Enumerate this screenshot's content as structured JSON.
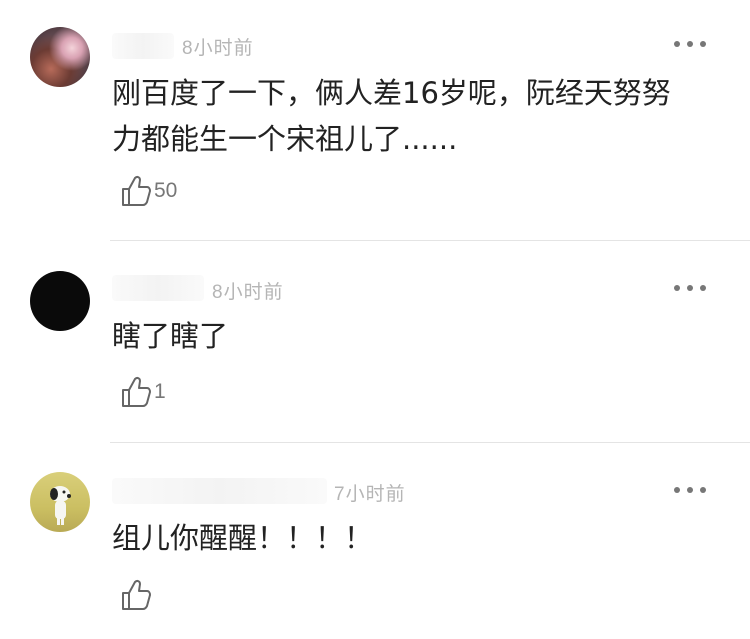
{
  "comments": [
    {
      "time": "8小时前",
      "text_line1": "刚百度了一下，俩人差16岁呢，阮经天努努",
      "text_line2": "力都能生一个宋祖儿了......",
      "likes": "50"
    },
    {
      "time": "8小时前",
      "text_line1": "瞎了瞎了",
      "likes": "1"
    },
    {
      "time": "7小时前",
      "text_line1": "组儿你醒醒！！！！",
      "likes": ""
    }
  ],
  "icons": {
    "more": "more-dots-icon",
    "like": "thumbs-up-icon"
  }
}
